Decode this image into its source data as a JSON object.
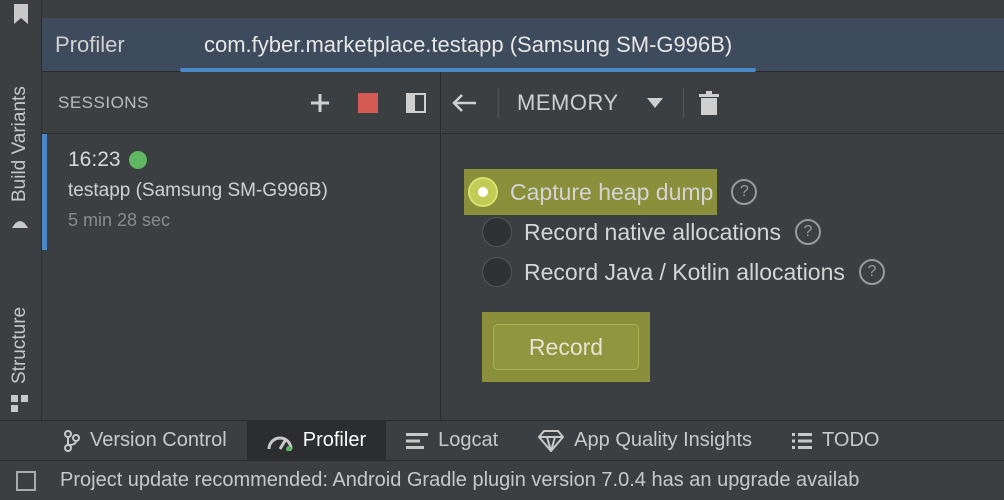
{
  "left_strip": {
    "build_variants": "Build Variants",
    "structure": "Structure"
  },
  "titlebar": {
    "tool_title": "Profiler",
    "session_tab": "com.fyber.marketplace.testapp (Samsung SM-G996B)"
  },
  "sessions": {
    "header": "SESSIONS",
    "item": {
      "time": "16:23",
      "name": "testapp (Samsung SM-G996B)",
      "duration": "5 min 28 sec"
    }
  },
  "memory": {
    "selector": "MEMORY",
    "options": [
      {
        "label": "Capture heap dump",
        "selected": true
      },
      {
        "label": "Record native allocations",
        "selected": false
      },
      {
        "label": "Record Java / Kotlin allocations",
        "selected": false
      }
    ],
    "record_label": "Record"
  },
  "bottom_tabs": [
    {
      "label": "Version Control",
      "icon": "branch-icon"
    },
    {
      "label": "Profiler",
      "icon": "gauge-icon"
    },
    {
      "label": "Logcat",
      "icon": "list-icon"
    },
    {
      "label": "App Quality Insights",
      "icon": "diamond-icon"
    },
    {
      "label": "TODO",
      "icon": "todo-icon"
    }
  ],
  "status": {
    "message": "Project update recommended: Android Gradle plugin version 7.0.4 has an upgrade availab"
  },
  "colors": {
    "accent": "#4a88c7",
    "highlight": "#c9d234",
    "status_green": "#5fb760",
    "stop_red": "#d75b55"
  }
}
